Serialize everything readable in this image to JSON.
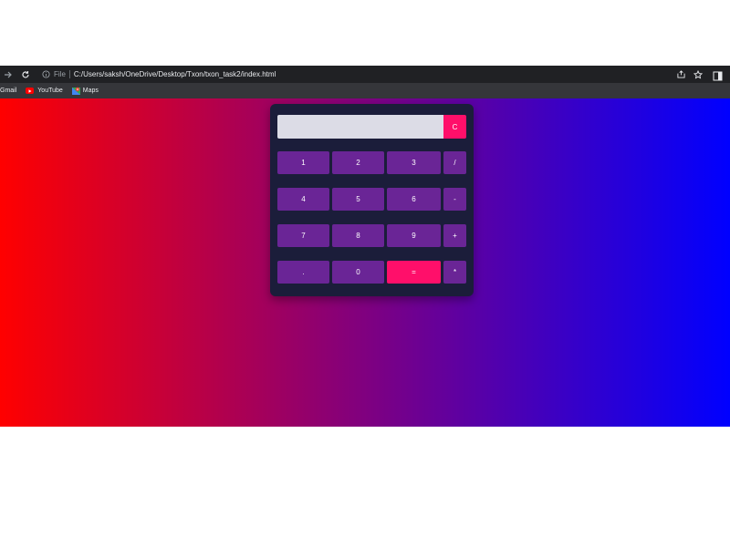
{
  "browser": {
    "file_label": "File",
    "url": "C:/Users/saksh/OneDrive/Desktop/Txon/txon_task2/index.html"
  },
  "bookmarks": [
    {
      "label": "Gmail",
      "icon": "gmail-icon"
    },
    {
      "label": "YouTube",
      "icon": "youtube-icon"
    },
    {
      "label": "Maps",
      "icon": "maps-icon"
    }
  ],
  "colors": {
    "gradient_start": "#ff0000",
    "gradient_end": "#0000ff",
    "calc_body": "#1b1d3a",
    "key": "#6a2596",
    "key_accent": "#ff0f6a",
    "display": "#dcdce6"
  },
  "calculator": {
    "display_value": "",
    "keys": {
      "clear": "C",
      "one": "1",
      "two": "2",
      "three": "3",
      "divide": "/",
      "four": "4",
      "five": "5",
      "six": "6",
      "minus": "-",
      "seven": "7",
      "eight": "8",
      "nine": "9",
      "plus": "+",
      "dot": ".",
      "zero": "0",
      "equals": "=",
      "multiply": "*"
    }
  }
}
